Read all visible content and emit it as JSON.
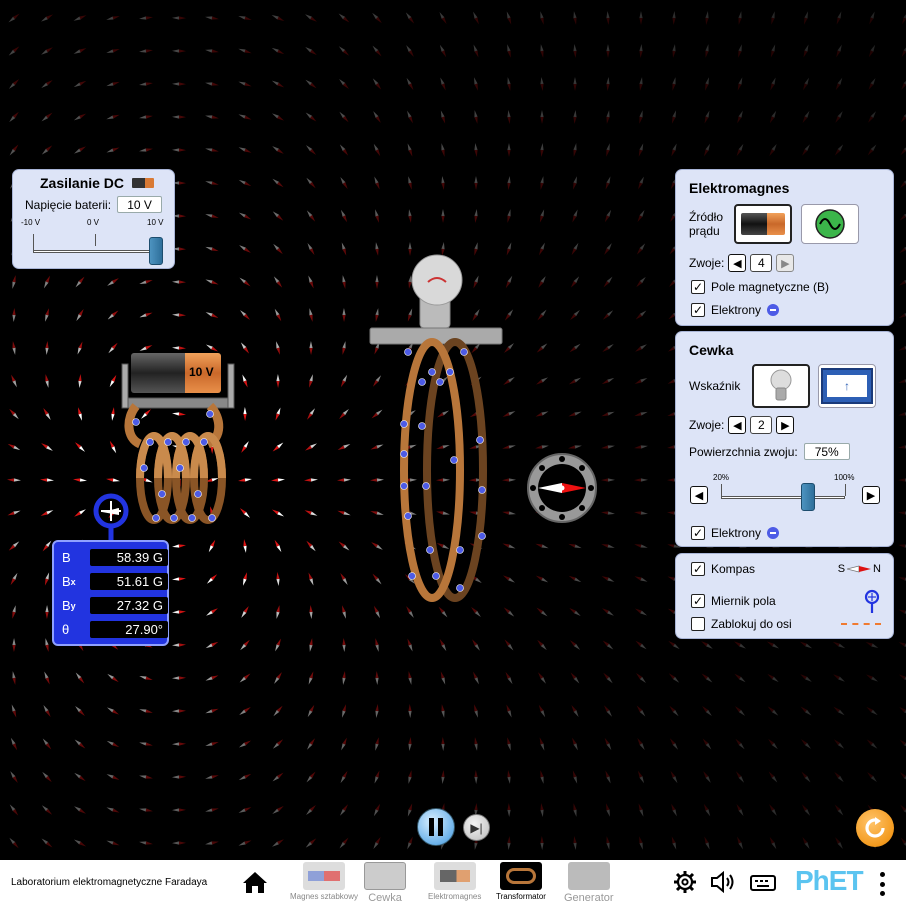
{
  "dc_panel": {
    "title": "Zasilanie DC",
    "voltage_label": "Napięcie baterii:",
    "voltage_value": "10 V",
    "ticks": [
      "-10 V",
      "0 V",
      "10 V"
    ]
  },
  "battery": {
    "label": "10 V"
  },
  "meter": {
    "rows": [
      {
        "label": "B",
        "sub": "",
        "value": "58.39 G"
      },
      {
        "label": "B",
        "sub": "x",
        "value": "51.61 G"
      },
      {
        "label": "B",
        "sub": "y",
        "value": "27.32 G"
      },
      {
        "label": "θ",
        "sub": "",
        "value": "27.90°"
      }
    ]
  },
  "electromagnet_panel": {
    "title": "Elektromagnes",
    "source_label": "Źródło prądu",
    "turns_label": "Zwoje:",
    "turns_value": "4",
    "magnetic_field_label": "Pole magnetyczne (B)",
    "electrons_label": "Elektrony"
  },
  "coil_panel": {
    "title": "Cewka",
    "indicator_label": "Wskaźnik",
    "turns_label": "Zwoje:",
    "turns_value": "2",
    "area_label": "Powierzchnia zwoju:",
    "area_value": "75%",
    "area_min": "20%",
    "area_max": "100%",
    "electrons_label": "Elektrony"
  },
  "tools_panel": {
    "compass_label": "Kompas",
    "compass_s": "S",
    "compass_n": "N",
    "field_meter_label": "Miernik pola",
    "lock_axis_label": "Zablokuj do osi"
  },
  "bottombar": {
    "app_title": "Laboratorium elektromagnetyczne Faradaya",
    "tabs": [
      {
        "label": "Magnes sztabkowy"
      },
      {
        "label": "Cewka"
      },
      {
        "label": "Elektromagnes"
      },
      {
        "label": "Transformator"
      },
      {
        "label": "Generator"
      }
    ],
    "brand": "PhET"
  },
  "colors": {
    "panel_bg": "#dde4f7",
    "meter_bg": "#2234e0",
    "coil_copper": "#b8763a",
    "electron_blue": "#4d5be6",
    "reset_orange": "#f39a1e"
  }
}
